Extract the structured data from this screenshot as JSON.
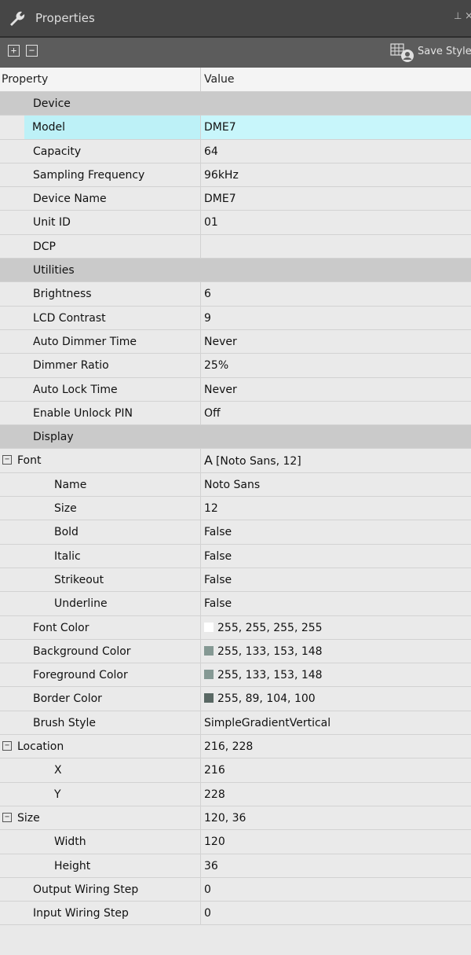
{
  "window": {
    "title": "Properties",
    "pin_glyph": "⊥",
    "close_glyph": "×"
  },
  "toolbar": {
    "expand_all": "+",
    "collapse_all": "−",
    "save_style_label": "Save Style"
  },
  "columns": {
    "property": "Property",
    "value": "Value"
  },
  "rows": [
    {
      "kind": "section",
      "name": "Device",
      "value": ""
    },
    {
      "kind": "item",
      "name": "Model",
      "value": "DME7",
      "selected": true
    },
    {
      "kind": "item",
      "name": "Capacity",
      "value": "64"
    },
    {
      "kind": "item",
      "name": "Sampling Frequency",
      "value": "96kHz"
    },
    {
      "kind": "item",
      "name": "Device Name",
      "value": "DME7"
    },
    {
      "kind": "item",
      "name": "Unit ID",
      "value": "01"
    },
    {
      "kind": "item",
      "name": "DCP",
      "value": ""
    },
    {
      "kind": "section",
      "name": "Utilities",
      "value": ""
    },
    {
      "kind": "item",
      "name": "Brightness",
      "value": "6"
    },
    {
      "kind": "item",
      "name": "LCD Contrast",
      "value": "9"
    },
    {
      "kind": "item",
      "name": "Auto Dimmer Time",
      "value": "Never"
    },
    {
      "kind": "item",
      "name": "Dimmer Ratio",
      "value": "25%"
    },
    {
      "kind": "item",
      "name": "Auto Lock Time",
      "value": "Never"
    },
    {
      "kind": "item",
      "name": "Enable Unlock PIN",
      "value": "Off"
    },
    {
      "kind": "section",
      "name": "Display",
      "value": ""
    },
    {
      "kind": "group",
      "name": "Font",
      "value": "[Noto Sans, 12]",
      "glyph": "A",
      "expander": "−"
    },
    {
      "kind": "child",
      "name": "Name",
      "value": "Noto Sans"
    },
    {
      "kind": "child",
      "name": "Size",
      "value": "12"
    },
    {
      "kind": "child",
      "name": "Bold",
      "value": "False"
    },
    {
      "kind": "child",
      "name": "Italic",
      "value": "False"
    },
    {
      "kind": "child",
      "name": "Strikeout",
      "value": "False"
    },
    {
      "kind": "child",
      "name": "Underline",
      "value": "False"
    },
    {
      "kind": "item",
      "name": "Font Color",
      "value": "255, 255, 255, 255",
      "swatch": "#ffffff"
    },
    {
      "kind": "item",
      "name": "Background Color",
      "value": "255, 133, 153, 148",
      "swatch": "#859994"
    },
    {
      "kind": "item",
      "name": "Foreground Color",
      "value": "255, 133, 153, 148",
      "swatch": "#859994"
    },
    {
      "kind": "item",
      "name": "Border Color",
      "value": "255, 89, 104, 100",
      "swatch": "#596864"
    },
    {
      "kind": "item",
      "name": "Brush Style",
      "value": "SimpleGradientVertical"
    },
    {
      "kind": "group",
      "name": "Location",
      "value": "216, 228",
      "expander": "−"
    },
    {
      "kind": "child",
      "name": "X",
      "value": "216"
    },
    {
      "kind": "child",
      "name": "Y",
      "value": "228"
    },
    {
      "kind": "group",
      "name": "Size",
      "value": "120, 36",
      "expander": "−"
    },
    {
      "kind": "child",
      "name": "Width",
      "value": "120"
    },
    {
      "kind": "child",
      "name": "Height",
      "value": "36"
    },
    {
      "kind": "item",
      "name": "Output Wiring Step",
      "value": "0"
    },
    {
      "kind": "item",
      "name": "Input Wiring Step",
      "value": "0"
    }
  ],
  "icons": {
    "title": "wrench-icon",
    "save": "save-style-icon",
    "expander": "collapse-box-icon"
  },
  "colors": {
    "selected_row": "#c8f6fb",
    "section": "#cacaca",
    "titlebar": "#464646",
    "toolbar": "#5c5c5c"
  }
}
